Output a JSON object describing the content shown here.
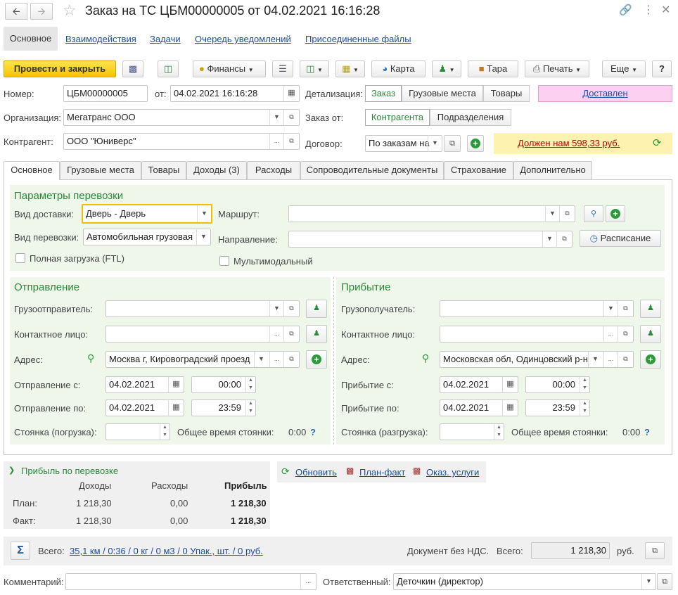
{
  "window": {
    "title": "Заказ на ТС ЦБМ00000005 от 04.02.2021 16:16:28"
  },
  "nav_tabs": [
    "Основное",
    "Взаимодействия",
    "Задачи",
    "Очередь уведомлений",
    "Присоединенные файлы"
  ],
  "toolbar": {
    "post_close": "Провести и закрыть",
    "finance": "Финансы",
    "map": "Карта",
    "tara": "Тара",
    "print": "Печать",
    "more": "Еще",
    "help": "?"
  },
  "header": {
    "number_label": "Номер:",
    "number": "ЦБМ00000005",
    "date_label": "от:",
    "date": "04.02.2021 16:16:28",
    "org_label": "Организация:",
    "org": "Мегатранс ООО",
    "contractor_label": "Контрагент:",
    "contractor": "ООО \"Юниверс\"",
    "detail_label": "Детализация:",
    "detail_options": [
      "Заказ",
      "Грузовые места",
      "Товары"
    ],
    "status": "Доставлен",
    "order_from_label": "Заказ от:",
    "order_from_options": [
      "Контрагента",
      "Подразделения"
    ],
    "contract_label": "Договор:",
    "contract": "По заказам на",
    "debt": "Должен нам 598,33 руб."
  },
  "tabs": [
    "Основное",
    "Грузовые места",
    "Товары",
    "Доходы (3)",
    "Расходы",
    "Сопроводительные документы",
    "Страхование",
    "Дополнительно"
  ],
  "params": {
    "title": "Параметры перевозки",
    "delivery_label": "Вид доставки:",
    "delivery": "Дверь - Дверь",
    "transport_label": "Вид перевозки:",
    "transport": "Автомобильная грузовая",
    "ftl_label": "Полная загрузка (FTL)",
    "route_label": "Маршрут:",
    "route": "",
    "direction_label": "Направление:",
    "direction": "",
    "schedule": "Расписание",
    "multimodal_label": "Мультимодальный"
  },
  "departure": {
    "title": "Отправление",
    "shipper_label": "Грузоотправитель:",
    "shipper": "",
    "contact_label": "Контактное лицо:",
    "contact": "",
    "address_label": "Адрес:",
    "address": "Москва г, Кировоградский проезд",
    "from_label": "Отправление с:",
    "from_date": "04.02.2021",
    "from_time": "00:00",
    "to_label": "Отправление по:",
    "to_date": "04.02.2021",
    "to_time": "23:59",
    "stay_label": "Стоянка (погрузка):",
    "stay": "",
    "total_label": "Общее время стоянки:",
    "total": "0:00",
    "q": "?"
  },
  "arrival": {
    "title": "Прибытие",
    "consignee_label": "Грузополучатель:",
    "consignee": "",
    "contact_label": "Контактное лицо:",
    "contact": "",
    "address_label": "Адрес:",
    "address": "Московская обл, Одинцовский р-н",
    "from_label": "Прибытие с:",
    "from_date": "04.02.2021",
    "from_time": "00:00",
    "to_label": "Прибытие по:",
    "to_date": "04.02.2021",
    "to_time": "23:59",
    "stay_label": "Стоянка (разгрузка):",
    "stay": "",
    "total_label": "Общее время стоянки:",
    "total": "0:00",
    "q": "?"
  },
  "profit": {
    "title": "Прибыль по перевозке",
    "headers": [
      "Доходы",
      "Расходы",
      "Прибыль"
    ],
    "rows": [
      {
        "label": "План:",
        "income": "1 218,30",
        "expense": "0,00",
        "profit": "1 218,30"
      },
      {
        "label": "Факт:",
        "income": "1 218,30",
        "expense": "0,00",
        "profit": "1 218,30"
      }
    ]
  },
  "links": {
    "refresh": "Обновить",
    "planfact": "План-факт",
    "services": "Оказ. услуги"
  },
  "footer": {
    "total_label": "Всего:",
    "total_link": "35,1 км / 0:36 / 0 кг / 0 м3 / 0 Упак., шт. / 0 руб.",
    "vat": "Документ без НДС.",
    "total2_label": "Всего:",
    "total2": "1 218,30",
    "currency": "руб.",
    "sigma": "Σ"
  },
  "bottom": {
    "comment_label": "Комментарий:",
    "comment": "",
    "responsible_label": "Ответственный:",
    "responsible": "Деточкин (директор)"
  }
}
